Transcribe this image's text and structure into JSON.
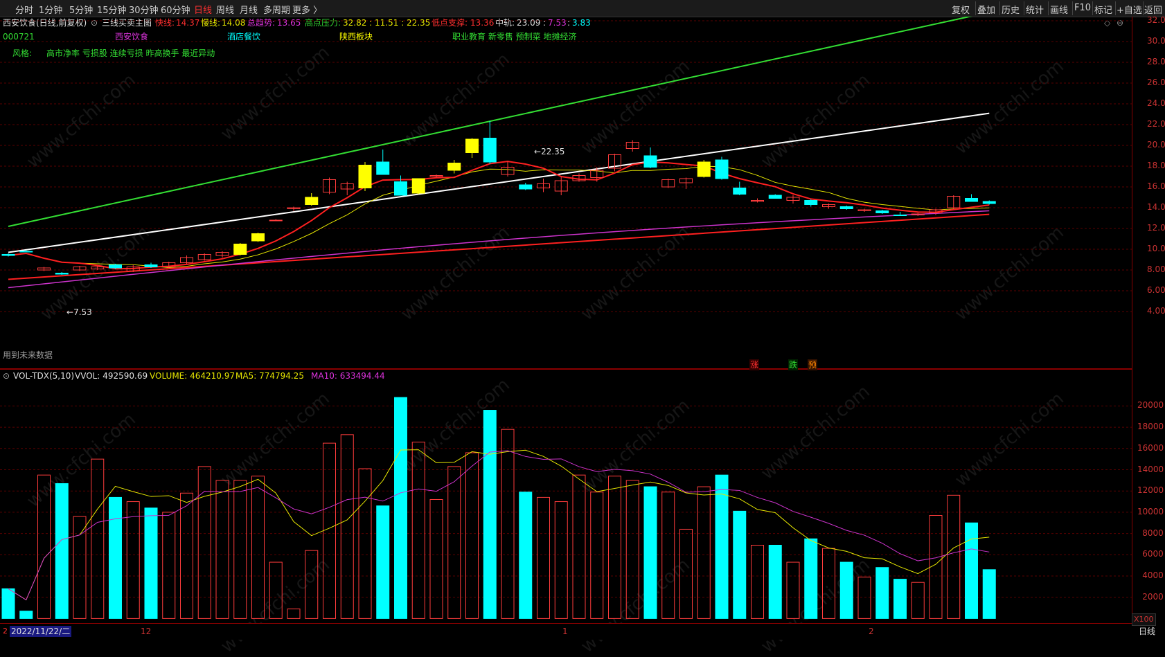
{
  "toolbar": {
    "periods": [
      "分时",
      "1分钟",
      "5分钟",
      "15分钟",
      "30分钟",
      "60分钟",
      "日线",
      "周线",
      "月线",
      "多周期",
      "更多 〉"
    ],
    "active_period": "日线",
    "right_buttons": [
      "复权",
      "叠加",
      "历史",
      "统计",
      "画线",
      "F10",
      "标记",
      "+自选",
      "返回"
    ]
  },
  "header": {
    "stock_title": "西安饮食(日线,前复权)",
    "indicator_name": "三线买卖主图",
    "fast_label": "快线:",
    "fast_value": "14.37",
    "slow_label": "慢线:",
    "slow_value": "14.08",
    "trend_label": "总趋势:",
    "trend_value": "13.65",
    "resist_label": "高点压力:",
    "resist_values": "32.82 : 11.51 : 22.35",
    "support_label": "低点支撑:",
    "support_value": "13.36",
    "mid_label": "中轨:",
    "mid_value": "23.09",
    "mid_extra1": "7.53",
    "mid_extra2": "3.83",
    "code": "000721",
    "name_tag": "西安饮食",
    "industry": "酒店餐饮",
    "region": "陕西板块",
    "concepts": "职业教育 新零售 预制菜 地摊经济",
    "style_label": "风格:",
    "styles": "高市净率 亏损股 连续亏损 昨高换手 最近异动"
  },
  "annotations": {
    "high_label": "22.35",
    "low_label": "7.53",
    "future_note": "用到未来数据",
    "sig_up": "涨",
    "sig_down": "跌",
    "sig_pre": "预"
  },
  "volume_header": {
    "name": "VOL-TDX(5,10)",
    "vvol": "VVOL: 492590.69",
    "volume": "VOLUME: 464210.97",
    "ma5": "MA5: 774794.25",
    "ma10": "MA10: 633494.44"
  },
  "price_axis": [
    "32.00",
    "30.00",
    "28.00",
    "26.00",
    "24.00",
    "22.00",
    "20.00",
    "18.00",
    "16.00",
    "14.00",
    "12.00",
    "10.00",
    "8.00",
    "6.00",
    "4.00"
  ],
  "volume_axis": [
    "20000",
    "18000",
    "16000",
    "14000",
    "12000",
    "10000",
    "8000",
    "6000",
    "4000",
    "2000"
  ],
  "volume_unit": "X100",
  "xaxis": {
    "cursor_date": "2022/11/22/二",
    "month_12": "12",
    "month_1": "1",
    "month_2": "2",
    "period": "日线"
  },
  "watermark": "www.cfchi.com",
  "colors": {
    "up": "#ff3c3c",
    "down": "#00ffff",
    "signal_yellow": "#ffff00",
    "fast_line": "#ff2020",
    "slow_line": "#e6e600",
    "trend_line": "#cc33cc",
    "resist_line": "#33dd33",
    "mid_line": "#ffffff"
  },
  "chart_data": {
    "type": "candlestick",
    "x_start_date": "2022/11/22",
    "ohlc": [
      [
        9.5,
        9.6,
        9.3,
        9.4,
        "d"
      ],
      [
        9.8,
        9.9,
        9.7,
        9.8,
        "d"
      ],
      [
        8.0,
        8.3,
        7.9,
        8.2,
        "u"
      ],
      [
        7.7,
        7.8,
        7.53,
        7.6,
        "d"
      ],
      [
        8.0,
        8.4,
        7.9,
        8.3,
        "u"
      ],
      [
        8.1,
        8.4,
        8.0,
        8.3,
        "u"
      ],
      [
        8.5,
        8.6,
        8.1,
        8.2,
        "d"
      ],
      [
        7.9,
        8.5,
        7.8,
        8.3,
        "u"
      ],
      [
        8.5,
        8.7,
        8.2,
        8.3,
        "d"
      ],
      [
        8.3,
        8.8,
        8.2,
        8.7,
        "u"
      ],
      [
        8.7,
        9.4,
        8.6,
        9.2,
        "u"
      ],
      [
        9.0,
        9.6,
        8.9,
        9.5,
        "u"
      ],
      [
        9.4,
        9.8,
        9.2,
        9.7,
        "u"
      ],
      [
        9.5,
        10.6,
        9.4,
        10.5,
        "y"
      ],
      [
        10.8,
        11.6,
        10.7,
        11.5,
        "y"
      ],
      [
        12.8,
        12.9,
        12.7,
        12.8,
        "u"
      ],
      [
        13.9,
        14.1,
        13.7,
        14.0,
        "u"
      ],
      [
        14.3,
        15.4,
        14.2,
        15.0,
        "y"
      ],
      [
        15.5,
        16.9,
        15.3,
        16.7,
        "u"
      ],
      [
        15.8,
        16.5,
        15.2,
        16.3,
        "u"
      ],
      [
        15.9,
        18.4,
        15.6,
        18.1,
        "y"
      ],
      [
        18.4,
        19.6,
        17.2,
        17.2,
        "d"
      ],
      [
        16.5,
        17.1,
        15.4,
        15.2,
        "d"
      ],
      [
        15.4,
        16.8,
        15.3,
        16.8,
        "y"
      ],
      [
        17.0,
        17.2,
        16.9,
        17.1,
        "u"
      ],
      [
        17.6,
        18.6,
        17.3,
        18.3,
        "y"
      ],
      [
        19.3,
        20.7,
        18.8,
        20.6,
        "y"
      ],
      [
        20.7,
        22.35,
        18.2,
        18.4,
        "d"
      ],
      [
        17.2,
        18.5,
        17.0,
        17.9,
        "u"
      ],
      [
        16.2,
        16.4,
        15.7,
        15.8,
        "d"
      ],
      [
        15.9,
        16.8,
        15.5,
        16.3,
        "u"
      ],
      [
        15.6,
        17.0,
        15.2,
        16.6,
        "u"
      ],
      [
        16.6,
        17.3,
        16.5,
        17.1,
        "u"
      ],
      [
        16.9,
        17.9,
        16.5,
        17.6,
        "u"
      ],
      [
        17.8,
        19.2,
        17.5,
        19.1,
        "u"
      ],
      [
        19.7,
        20.5,
        19.4,
        20.3,
        "u"
      ],
      [
        19.0,
        19.8,
        17.8,
        17.9,
        "d"
      ],
      [
        16.0,
        16.8,
        15.9,
        16.7,
        "u"
      ],
      [
        16.4,
        16.9,
        15.8,
        16.8,
        "u"
      ],
      [
        17.0,
        18.6,
        16.9,
        18.4,
        "y"
      ],
      [
        18.6,
        18.9,
        16.7,
        16.8,
        "d"
      ],
      [
        15.9,
        16.5,
        15.2,
        15.3,
        "d"
      ],
      [
        14.6,
        14.9,
        14.5,
        14.7,
        "u"
      ],
      [
        15.2,
        15.3,
        14.9,
        14.9,
        "d"
      ],
      [
        14.7,
        15.2,
        14.4,
        15.0,
        "u"
      ],
      [
        14.7,
        14.8,
        14.1,
        14.3,
        "d"
      ],
      [
        14.1,
        14.4,
        13.9,
        14.3,
        "u"
      ],
      [
        14.1,
        14.2,
        13.8,
        13.9,
        "d"
      ],
      [
        13.7,
        13.9,
        13.6,
        13.8,
        "u"
      ],
      [
        13.7,
        13.8,
        13.4,
        13.5,
        "d"
      ],
      [
        13.3,
        13.6,
        13.2,
        13.3,
        "d"
      ],
      [
        13.3,
        13.5,
        13.2,
        13.4,
        "u"
      ],
      [
        13.5,
        13.9,
        13.3,
        13.8,
        "u"
      ],
      [
        14.0,
        15.2,
        13.9,
        15.1,
        "u"
      ],
      [
        14.9,
        15.3,
        14.6,
        14.6,
        "d"
      ],
      [
        14.6,
        14.7,
        14.3,
        14.4,
        "d"
      ]
    ],
    "volume": [
      2800,
      700,
      13500,
      12700,
      9600,
      15000,
      11400,
      11000,
      10400,
      10000,
      11800,
      14300,
      13000,
      13000,
      13400,
      5300,
      900,
      6400,
      16500,
      17300,
      14100,
      10600,
      20800,
      16600,
      11200,
      14300,
      15600,
      19600,
      17800,
      11900,
      11400,
      11000,
      13500,
      11900,
      13400,
      13000,
      12400,
      11900,
      8400,
      12400,
      13500,
      10100,
      6900,
      6900,
      5300,
      7500,
      6600,
      5300,
      3900,
      4800,
      3700,
      3400,
      9700,
      11600,
      9000,
      4600
    ],
    "volume_colors": "u: hollow red, d: filled cyan",
    "ylim_price": [
      4,
      33
    ],
    "ylim_volume": [
      0,
      21000
    ]
  }
}
